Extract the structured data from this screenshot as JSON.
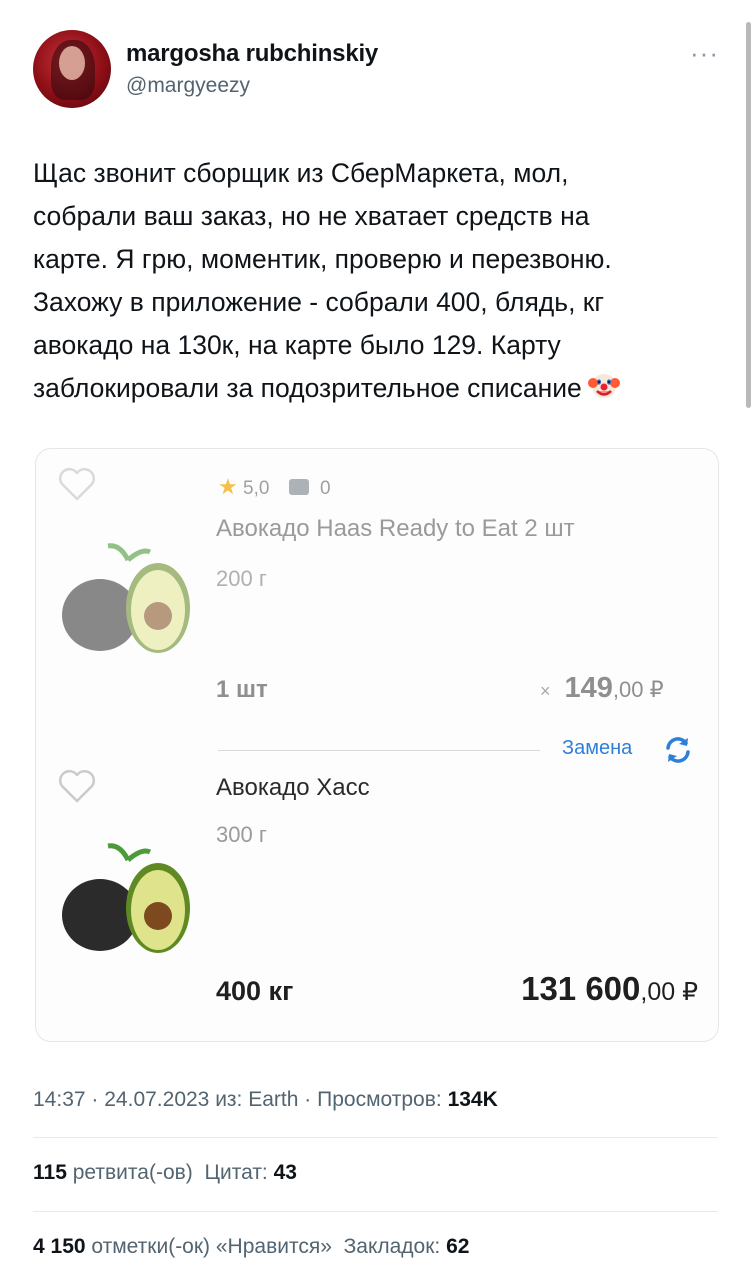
{
  "author": {
    "display_name": "margosha rubchinskiy",
    "handle": "@margyeezy"
  },
  "more_label": "···",
  "tweet": {
    "lines": [
      "Щас звонит сборщик из СберМаркета, мол,",
      "собрали ваш заказ, но не хватает средств на",
      "карте. Я грю, моментик, проверю и перезвоню.",
      "Захожу в приложение - собрали 400, блядь, кг",
      "авокадо на 130к, на карте было 129. Карту",
      "заблокировали за подозрительное списание"
    ],
    "emoji": "clown-face"
  },
  "order_card": {
    "original_item": {
      "rating": "5,0",
      "reviews": "0",
      "name": "Авокадо Haas Ready to Eat 2 шт",
      "weight": "200 г",
      "quantity": "1 шт",
      "times": "×",
      "price_main": "149",
      "price_cents": ",00 ₽"
    },
    "replacement_label": "Замена",
    "replacement_item": {
      "name": "Авокадо Хасс",
      "weight": "300 г",
      "quantity": "400 кг",
      "price_main": "131 600",
      "price_cents": ",00 ₽"
    }
  },
  "meta": {
    "time": "14:37",
    "date": "24.07.2023",
    "source_prefix": "из:",
    "source": "Earth",
    "views_label": "Просмотров:",
    "views": "134K",
    "sep": "·"
  },
  "stats": {
    "retweets": "115",
    "retweets_label": "ретвита(-ов)",
    "quotes_label": "Цитат:",
    "quotes": "43",
    "likes": "4 150",
    "likes_label": "отметки(-ок) «Нравится»",
    "bookmarks_label": "Закладок:",
    "bookmarks": "62"
  },
  "colors": {
    "link_blue": "#2f7fd6",
    "secondary_text": "#536471",
    "avatar_red": "#8e0f17"
  }
}
